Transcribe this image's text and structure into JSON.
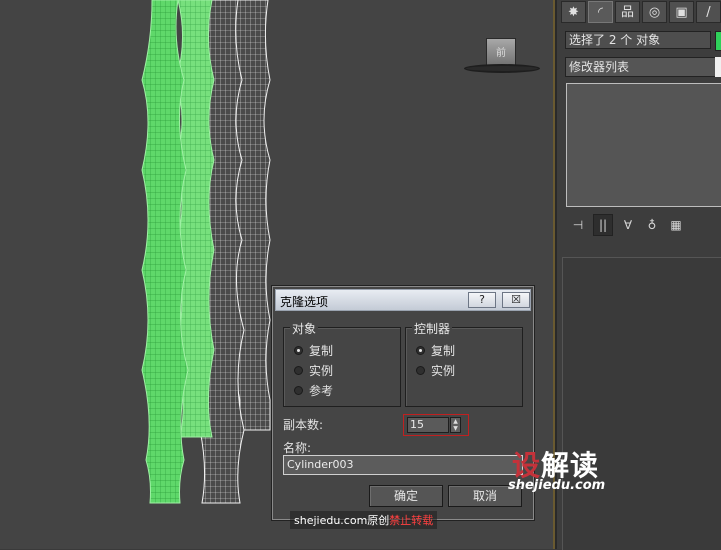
{
  "viewport": {
    "viewcube_label": "前"
  },
  "command_panel": {
    "tabs": [
      {
        "icon": "create-icon",
        "glyph": "✸"
      },
      {
        "icon": "modify-icon",
        "glyph": "◜"
      },
      {
        "icon": "hierarchy-icon",
        "glyph": "品"
      },
      {
        "icon": "motion-icon",
        "glyph": "◎"
      },
      {
        "icon": "display-icon",
        "glyph": "▣"
      },
      {
        "icon": "utilities-icon",
        "glyph": "/"
      }
    ],
    "selection_text": "选择了 2 个 对象",
    "selection_color": "#2fd15a",
    "modifier_list_label": "修改器列表",
    "stack_tools": [
      {
        "icon": "pin-stack-icon",
        "glyph": "⊣"
      },
      {
        "icon": "show-end-result-icon",
        "glyph": "||"
      },
      {
        "icon": "make-unique-icon",
        "glyph": "∀"
      },
      {
        "icon": "remove-modifier-icon",
        "glyph": "♁"
      },
      {
        "icon": "configure-sets-icon",
        "glyph": "▦"
      }
    ]
  },
  "dialog": {
    "title": "克隆选项",
    "help_button": "?",
    "close_button": "☒",
    "object_group": {
      "label": "对象",
      "options": [
        "复制",
        "实例",
        "参考"
      ],
      "selected": "复制"
    },
    "controller_group": {
      "label": "控制器",
      "options": [
        "复制",
        "实例"
      ],
      "selected": "复制"
    },
    "copies_label": "副本数:",
    "copies_value": "15",
    "name_label": "名称:",
    "name_value": "Cylinder003",
    "ok_button": "确定",
    "cancel_button": "取消"
  },
  "watermark": {
    "logo_first": "设",
    "logo_rest": "解读",
    "url": "shejiedu.com",
    "bottom_text": "shejiedu.com原创",
    "bottom_warning": "禁止转载"
  }
}
